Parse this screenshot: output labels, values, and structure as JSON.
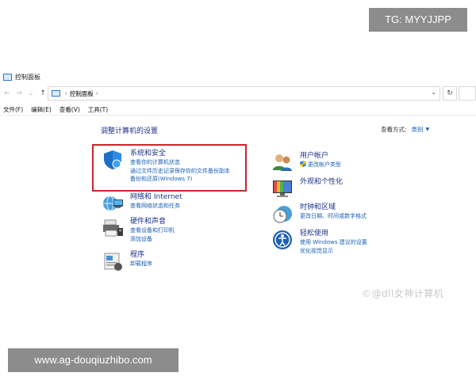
{
  "overlays": {
    "top_right": "TG: MYYJJPP",
    "bottom_left": "www.ag-douqiuzhibo.com",
    "watermark": "©@dll女神计算机"
  },
  "window": {
    "title": "控制面板"
  },
  "address": {
    "path": "控制面板"
  },
  "menu": {
    "file": "文件(F)",
    "edit": "编辑(E)",
    "view": "查看(V)",
    "tools": "工具(T)"
  },
  "main": {
    "heading": "调整计算机的设置",
    "view_by_label": "查看方式:",
    "view_by_value": "类别"
  },
  "categories_left": [
    {
      "title": "系统和安全",
      "links": [
        "查看你的计算机状态",
        "通过文件历史记录保存你的文件备份副本",
        "备份和还原(Windows 7)"
      ]
    },
    {
      "title": "网络和 Internet",
      "links": [
        "查看网络状态和任务"
      ]
    },
    {
      "title": "硬件和声音",
      "links": [
        "查看设备和打印机",
        "添加设备"
      ]
    },
    {
      "title": "程序",
      "links": [
        "卸载程序"
      ]
    }
  ],
  "categories_right": [
    {
      "title": "用户帐户",
      "links": [
        "更改帐户类型"
      ]
    },
    {
      "title": "外观和个性化",
      "links": []
    },
    {
      "title": "时钟和区域",
      "links": [
        "更改日期、时间或数字格式"
      ]
    },
    {
      "title": "轻松使用",
      "links": [
        "使用 Windows 建议的设置",
        "优化视觉显示"
      ]
    }
  ],
  "colors": {
    "title_link": "#1e3287",
    "sub_link": "#1a5fb4",
    "highlight_box": "#c9262b"
  }
}
